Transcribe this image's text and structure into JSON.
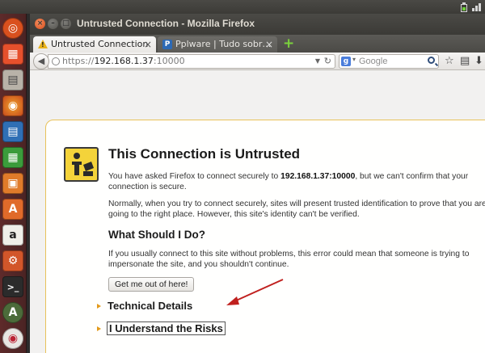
{
  "window": {
    "title": "Untrusted Connection - Mozilla Firefox"
  },
  "tabs": [
    {
      "label": "Untrusted Connection",
      "icon": "warning-triangle-icon",
      "active": true
    },
    {
      "label": "Pplware | Tudo sobr…",
      "icon": "pplware-favicon-icon",
      "active": false
    }
  ],
  "navbar": {
    "url_prefix": "https://",
    "url_host": "192.168.1.37",
    "url_port": ":10000",
    "search_placeholder": "Google"
  },
  "error_page": {
    "title": "This Connection is Untrusted",
    "intro_before": "You have asked Firefox to connect securely to ",
    "intro_host": "192.168.1.37:10000",
    "intro_after": ", but we can't confirm that your connection is secure.",
    "para2": "Normally, when you try to connect securely, sites will present trusted identification to prove that you are going to the right place. However, this site's identity can't be verified.",
    "subtitle": "What Should I Do?",
    "para3": "If you usually connect to this site without problems, this error could mean that someone is trying to impersonate the site, and you shouldn't continue.",
    "get_out_button": "Get me out of here!",
    "technical_details": "Technical Details",
    "understand_risks": "I Understand the Risks"
  },
  "colors": {
    "launcher": "#5e2a2a",
    "titlebar": "#3c3b37",
    "error_border": "#e8c25a",
    "expander_arrow": "#e39a1b",
    "annotation_arrow": "#c0201e"
  }
}
